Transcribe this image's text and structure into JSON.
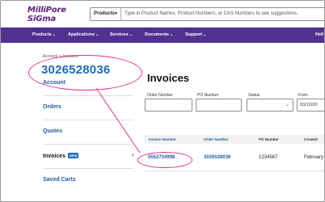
{
  "brand": {
    "line1": "MilliPore",
    "line2": "SiGma"
  },
  "search": {
    "category": "Products",
    "placeholder": "Type in Product Names, Product Numbers, or CAS Numbers to see suggestions."
  },
  "nav": {
    "items": [
      "Products",
      "Applications",
      "Services",
      "Documents",
      "Support"
    ],
    "right": "Hell"
  },
  "breadcrumb": {
    "parent": "Account",
    "separator": ">",
    "current": "Invoices"
  },
  "sidebar": {
    "items": [
      "Account",
      "Orders",
      "Quotes",
      "Invoices",
      "Saved Carts"
    ],
    "new_badge": "NEW"
  },
  "main": {
    "title": "Invoices",
    "filters": {
      "order_number_label": "Order Number",
      "po_number_label": "PO Number",
      "status_label": "Status",
      "from_label": "From",
      "from_value": "03/12/20"
    },
    "table": {
      "headers": [
        "Invoice Number",
        "Order Number",
        "PO Number",
        "Created"
      ],
      "row": {
        "invoice": "0552734998",
        "order": "3026528036",
        "po": "1234567",
        "created": "February"
      }
    }
  },
  "annotation": {
    "callout_number": "3026528036"
  },
  "colors": {
    "brand_purple": "#503190",
    "link_blue": "#1f5a9e",
    "highlight_pink": "#e0318a"
  }
}
